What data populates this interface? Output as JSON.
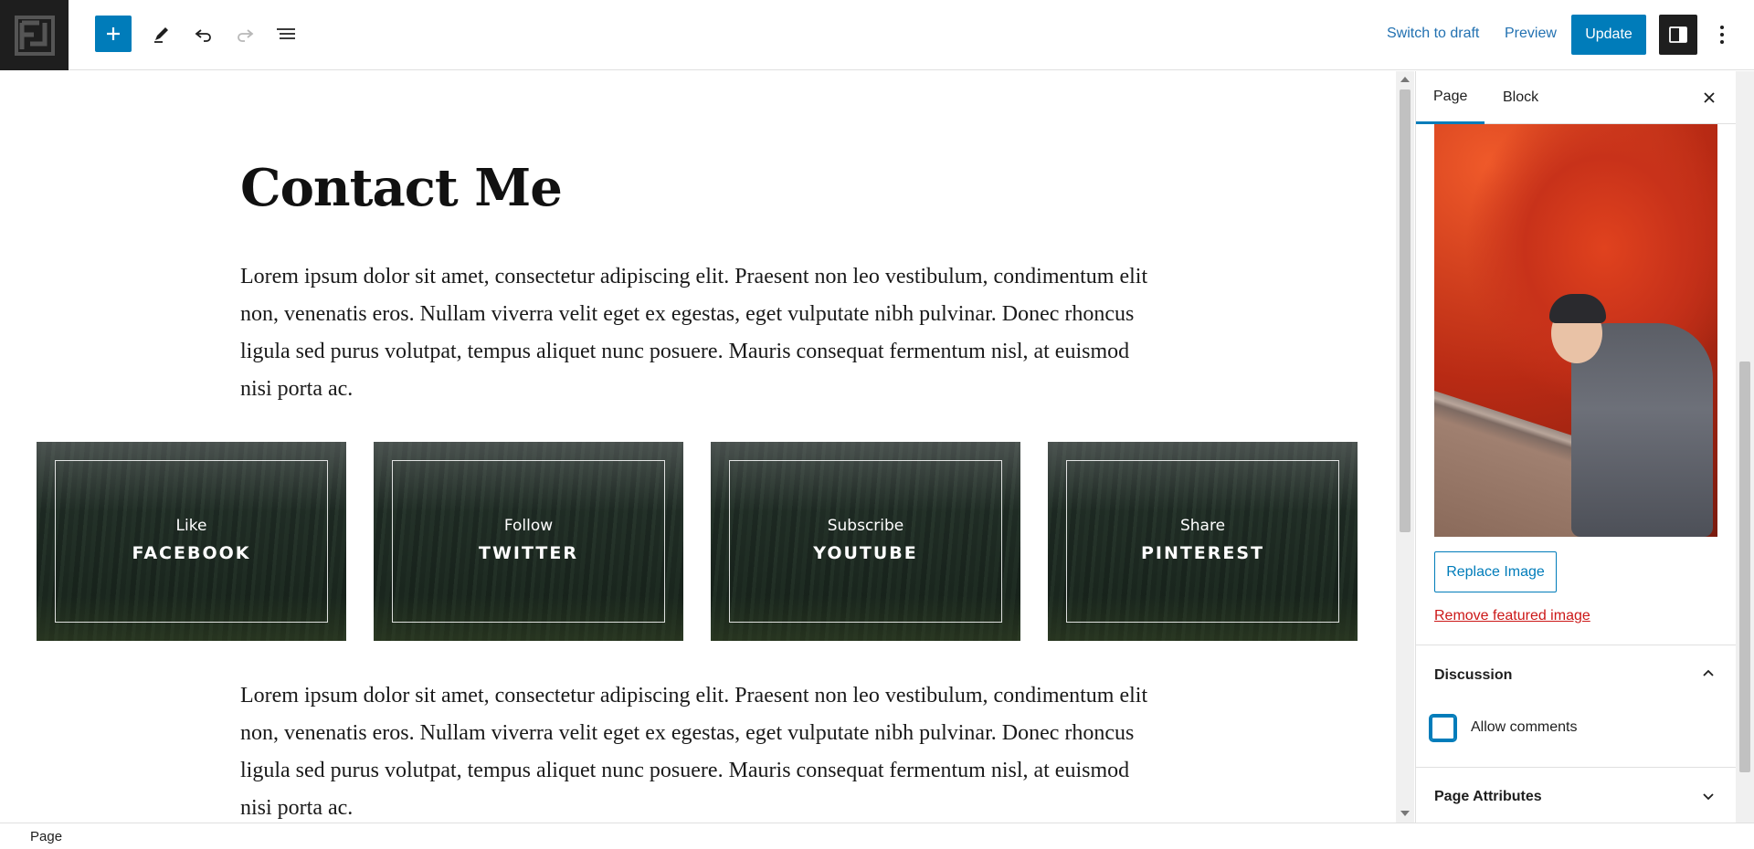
{
  "toolbar": {
    "add_icon": "plus-icon",
    "tools_icon": "pencil-icon",
    "undo_icon": "undo-icon",
    "redo_icon": "redo-icon",
    "list_view_icon": "list-view-icon",
    "switch_to_draft": "Switch to draft",
    "preview": "Preview",
    "update": "Update",
    "accent_color": "#007cba"
  },
  "content": {
    "title": "Contact Me",
    "paragraph_1": "Lorem ipsum dolor sit amet, consectetur adipiscing elit. Praesent non leo vestibulum, condimentum elit non, venenatis eros. Nullam viverra velit eget ex egestas, eget vulputate nibh pulvinar. Donec rhoncus ligula sed purus volutpat, tempus aliquet nunc posuere. Mauris consequat fermentum nisl, at euismod nisi porta ac.",
    "cards": [
      {
        "top": "Like",
        "bottom": "FACEBOOK"
      },
      {
        "top": "Follow",
        "bottom": "TWITTER"
      },
      {
        "top": "Subscribe",
        "bottom": "YOUTUBE"
      },
      {
        "top": "Share",
        "bottom": "PINTEREST"
      }
    ],
    "paragraph_2": "Lorem ipsum dolor sit amet, consectetur adipiscing elit. Praesent non leo vestibulum, condimentum elit non, venenatis eros. Nullam viverra velit eget ex egestas, eget vulputate nibh pulvinar. Donec rhoncus ligula sed purus volutpat, tempus aliquet nunc posuere. Mauris consequat fermentum nisl, at euismod nisi porta ac."
  },
  "sidebar": {
    "tabs": [
      {
        "label": "Page"
      },
      {
        "label": "Block"
      }
    ],
    "replace_image": "Replace Image",
    "remove_featured_image": "Remove featured image",
    "discussion": {
      "title": "Discussion",
      "allow_comments_label": "Allow comments",
      "allow_comments_checked": false
    },
    "page_attributes": {
      "title": "Page Attributes"
    }
  },
  "footer": {
    "breadcrumb": "Page"
  }
}
